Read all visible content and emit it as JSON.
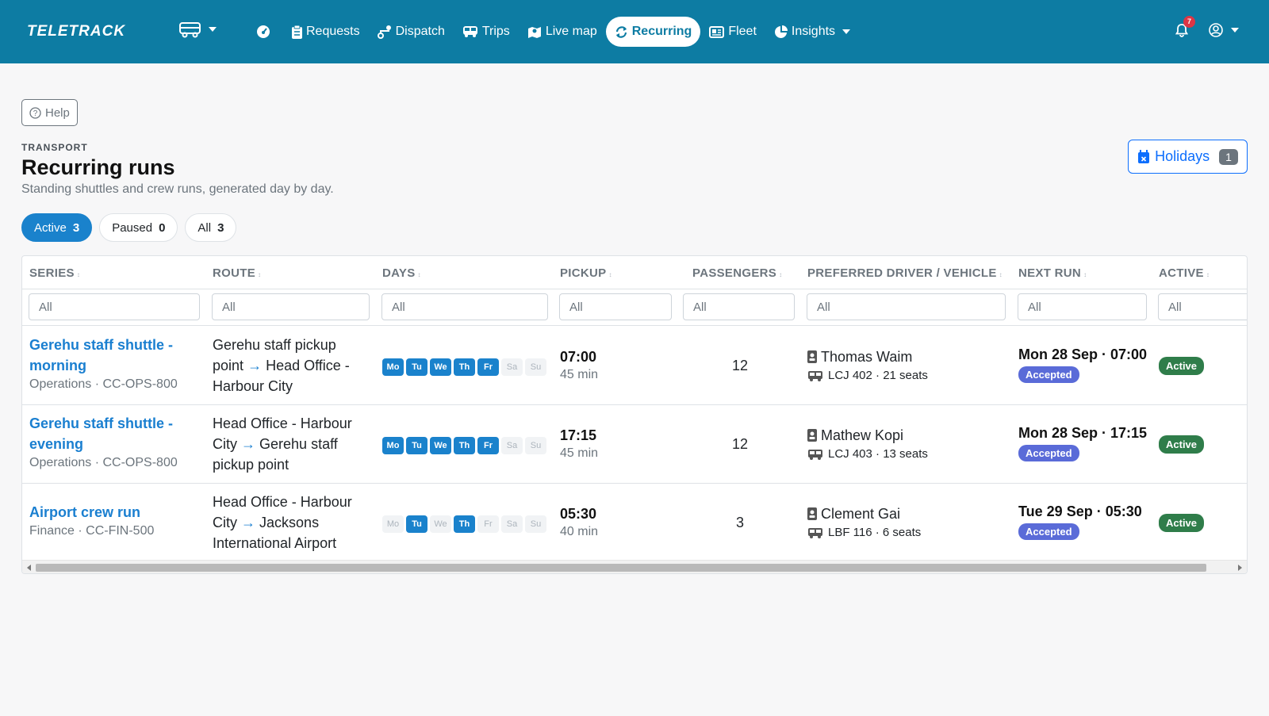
{
  "brand": "TELETRACK",
  "nav": {
    "items": [
      {
        "label": "",
        "icon": "dashboard-gauge-icon"
      },
      {
        "label": "Requests",
        "icon": "clipboard-icon"
      },
      {
        "label": "Dispatch",
        "icon": "route-icon"
      },
      {
        "label": "Trips",
        "icon": "bus-icon"
      },
      {
        "label": "Live map",
        "icon": "map-icon"
      },
      {
        "label": "Recurring",
        "icon": "repeat-icon"
      },
      {
        "label": "Fleet",
        "icon": "id-card-icon"
      },
      {
        "label": "Insights",
        "icon": "pie-chart-icon"
      }
    ],
    "notifications_count": "7"
  },
  "help_label": "Help",
  "header": {
    "eyebrow": "TRANSPORT",
    "title": "Recurring runs",
    "subtitle": "Standing shuttles and crew runs, generated day by day.",
    "holidays_label": "Holidays",
    "holidays_count": "1"
  },
  "tabs": [
    {
      "label": "Active",
      "count": "3"
    },
    {
      "label": "Paused",
      "count": "0"
    },
    {
      "label": "All",
      "count": "3"
    }
  ],
  "table": {
    "columns": [
      "SERIES",
      "ROUTE",
      "DAYS",
      "PICKUP",
      "PASSENGERS",
      "PREFERRED DRIVER / VEHICLE",
      "NEXT RUN",
      "ACTIVE"
    ],
    "filter_placeholder": "All",
    "day_labels": [
      "Mo",
      "Tu",
      "We",
      "Th",
      "Fr",
      "Sa",
      "Su"
    ],
    "rows": [
      {
        "series_line1": "Gerehu staff shuttle -",
        "series_line2": "morning",
        "meta": "Operations · CC-OPS-800",
        "route_from": "Gerehu staff pickup point",
        "route_arrow": "→",
        "route_to": "Head Office - Harbour City",
        "days_on": [
          true,
          true,
          true,
          true,
          true,
          false,
          false
        ],
        "pickup_time": "07:00",
        "pickup_duration": "45 min",
        "passengers": "12",
        "driver": "Thomas Waim",
        "vehicle": "LCJ 402 · 21 seats",
        "next_run": "Mon 28 Sep · 07:00",
        "status": "Accepted",
        "active": "Active"
      },
      {
        "series_line1": "Gerehu staff shuttle -",
        "series_line2": "evening",
        "meta": "Operations · CC-OPS-800",
        "route_from": "Head Office - Harbour City",
        "route_arrow": "→",
        "route_to": "Gerehu staff pickup point",
        "days_on": [
          true,
          true,
          true,
          true,
          true,
          false,
          false
        ],
        "pickup_time": "17:15",
        "pickup_duration": "45 min",
        "passengers": "12",
        "driver": "Mathew Kopi",
        "vehicle": "LCJ 403 · 13 seats",
        "next_run": "Mon 28 Sep · 17:15",
        "status": "Accepted",
        "active": "Active"
      },
      {
        "series_line1": "Airport crew run",
        "series_line2": "",
        "meta": "Finance · CC-FIN-500",
        "route_from": "Head Office - Harbour City",
        "route_arrow": "→",
        "route_to": "Jacksons International Airport",
        "days_on": [
          false,
          true,
          false,
          true,
          false,
          false,
          false
        ],
        "pickup_time": "05:30",
        "pickup_duration": "40 min",
        "passengers": "3",
        "driver": "Clement Gai",
        "vehicle": "LBF 116 · 6 seats",
        "next_run": "Tue 29 Sep · 05:30",
        "status": "Accepted",
        "active": "Active"
      }
    ]
  },
  "colors": {
    "navbar": "#0d7ca3",
    "link": "#1a7fd0",
    "day_on": "#1a82cc",
    "accepted": "#5a6bd8",
    "active": "#2f7d4a"
  }
}
